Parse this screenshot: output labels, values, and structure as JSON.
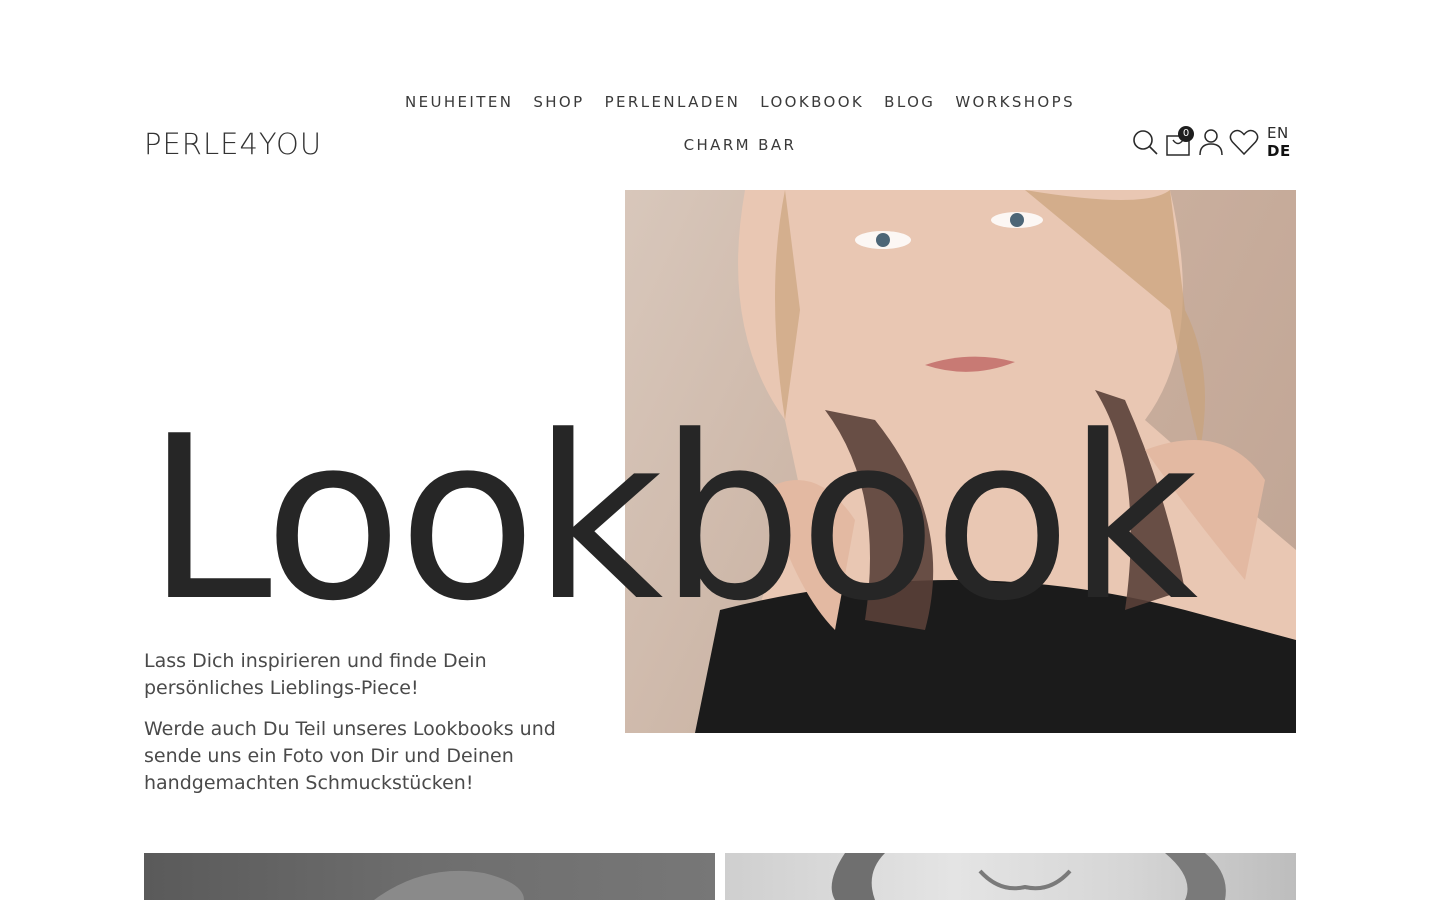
{
  "header": {
    "logo": "PERLE4YOU",
    "nav_row1": [
      "NEUHEITEN",
      "SHOP",
      "PERLENLADEN",
      "LOOKBOOK",
      "BLOG",
      "WORKSHOPS"
    ],
    "nav_row2": [
      "CHARM BAR"
    ],
    "cart_count": "0",
    "languages": {
      "en": "EN",
      "de": "DE",
      "active": "DE"
    },
    "icons": [
      "search-icon",
      "cart-icon",
      "user-icon",
      "heart-icon"
    ]
  },
  "hero": {
    "title": "Lookbook",
    "text1": "Lass Dich inspirieren und finde Dein persönliches Lieblings-Piece!",
    "text2": "Werde auch Du Teil unseres Lookbooks und sende uns ein Foto von Dir und Deinen handgemachten Schmuckstücken!"
  },
  "colors": {
    "text": "#2a2a2a",
    "photo_bg": "#cdb7a8",
    "badge": "#1e1e1e"
  }
}
